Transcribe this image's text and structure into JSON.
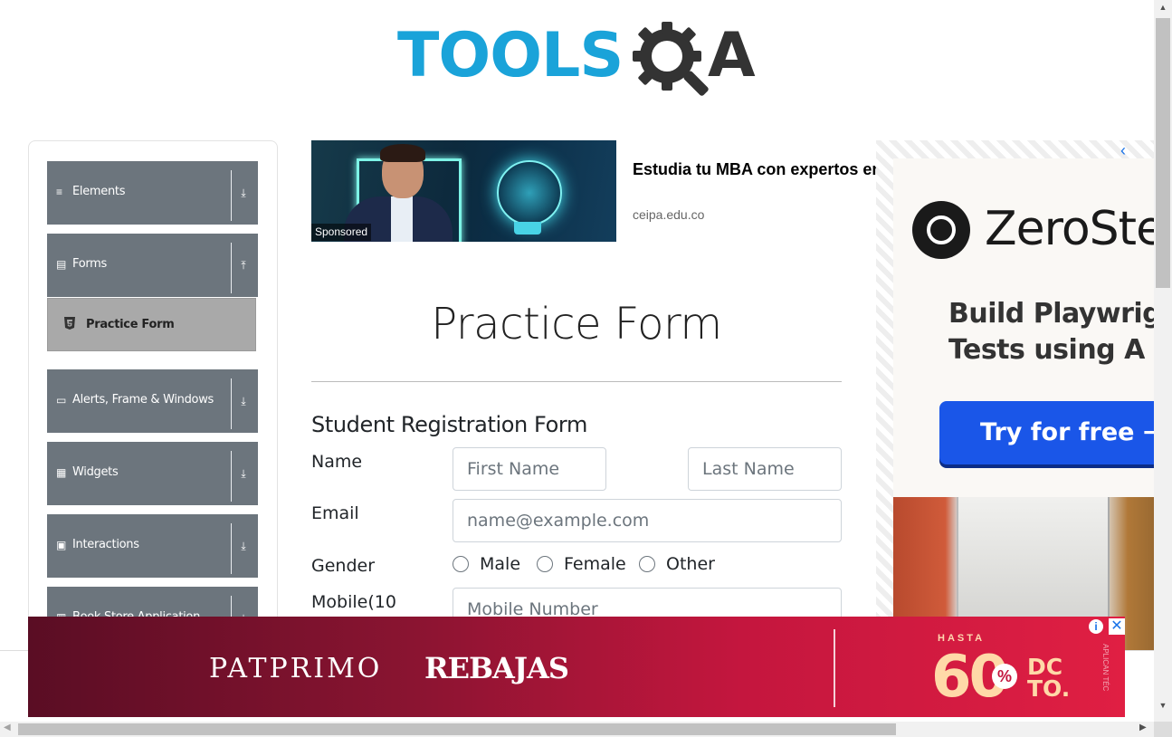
{
  "logo": {
    "text_blue": "TOOLS",
    "text_dark": "A",
    "alt": "TOOLSQA"
  },
  "sidebar": {
    "groups": [
      {
        "label": "Elements",
        "icon": "hamburger-icon",
        "arrow": "download-arrow-icon"
      },
      {
        "label": "Forms",
        "icon": "file-icon",
        "arrow": "upload-arrow-icon"
      },
      {
        "label": "Alerts, Frame & Windows",
        "icon": "window-icon",
        "arrow": "download-arrow-icon"
      },
      {
        "label": "Widgets",
        "icon": "grid-icon",
        "arrow": "download-arrow-icon"
      },
      {
        "label": "Interactions",
        "icon": "cursor-box-icon",
        "arrow": "download-arrow-icon"
      },
      {
        "label": "Book Store Application",
        "icon": "book-icon",
        "arrow": "download-arrow-icon"
      }
    ],
    "active_item": {
      "label": "Practice Form",
      "icon": "html5-icon"
    }
  },
  "top_ad": {
    "sponsored_label": "Sponsored",
    "headline": "Estudia tu MBA con expertos en administración",
    "domain": "ceipa.edu.co"
  },
  "form": {
    "page_title": "Practice Form",
    "heading": "Student Registration Form",
    "name_label": "Name",
    "first_name_placeholder": "First Name",
    "last_name_placeholder": "Last Name",
    "email_label": "Email",
    "email_placeholder": "name@example.com",
    "gender_label": "Gender",
    "gender_options": [
      "Male",
      "Female",
      "Other"
    ],
    "mobile_label": "Mobile(10",
    "mobile_placeholder": "Mobile Number"
  },
  "right_ad": {
    "brand": "ZeroSte",
    "tagline_line1": "Build Playwrigh",
    "tagline_line2": "Tests using A",
    "cta": "Try for free →"
  },
  "bottom_ad": {
    "brand": "PATPRIMO",
    "promo": "REBAJAS",
    "hasta": "HASTA",
    "discount": "60",
    "percent": "%",
    "dcto_line1": "DC",
    "dcto_line2": "TO.",
    "note": "APLICAN TÉC"
  },
  "colors": {
    "sidebar_group": "#6c757d",
    "sidebar_active": "#a9a9a9",
    "logo_blue": "#1aa3d9",
    "cta_blue": "#1a56e8",
    "bottom_ad_red": "#c4163e"
  }
}
